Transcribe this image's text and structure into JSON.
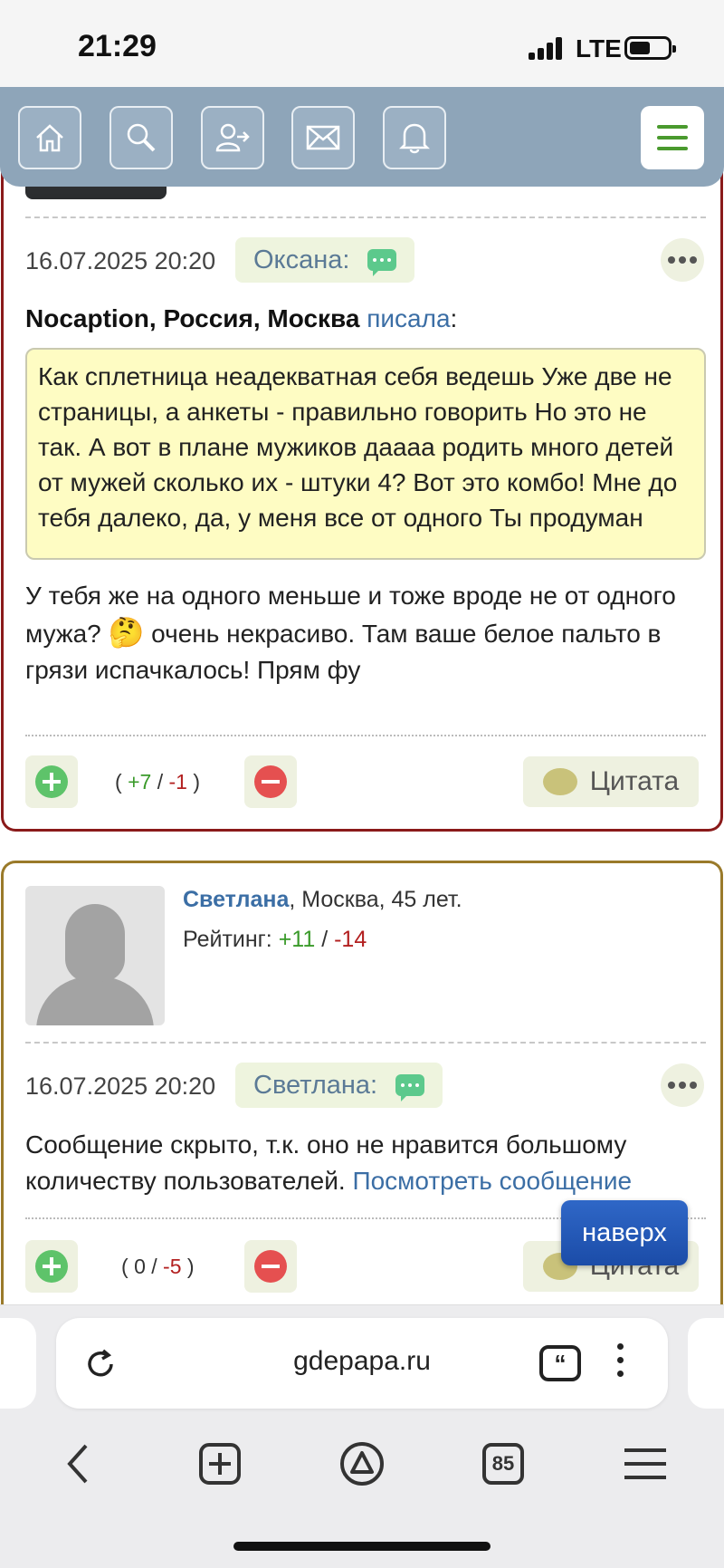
{
  "status": {
    "time": "21:29",
    "network": "LTE"
  },
  "nav": {
    "icons": [
      "home-icon",
      "search-icon",
      "login-icon",
      "mail-icon",
      "bell-icon",
      "menu-icon"
    ]
  },
  "post1": {
    "date": "16.07.2025 20:20",
    "author": "Оксана:",
    "quote_author": "Nocaption, Россия, Москва",
    "quote_verb": "писала",
    "quote_colon": ":",
    "quote_text": "Как сплетница неадекватная себя ведешь Уже две не страницы, а анкеты - правильно говорить Но это не так. А вот в плане мужиков даааа родить много детей от мужей сколько их - штуки 4? Вот это комбо! Мне до тебя далеко, да, у меня все от одного Ты продуман",
    "message_part1": "У тебя же на одного меньше и тоже вроде не от одного мужа?",
    "message_emoji": "🤔",
    "message_part2": "очень некрасиво. Там ваше белое пальто в грязи испачкалось! Прям фу",
    "votes": {
      "open": "(",
      "plus": "+7",
      "sep": "/",
      "minus": "-1",
      "close": ")"
    },
    "cite_label": "Цитата"
  },
  "post2": {
    "profile_name": "Светлана",
    "profile_info": ", Москва, 45 лет.",
    "rating_label": "Рейтинг:",
    "rating_plus": "+11",
    "rating_sep": "/",
    "rating_minus": "-14",
    "date": "16.07.2025 20:20",
    "author": "Светлана:",
    "hidden_text": "Сообщение скрыто, т.к. оно не нравится большому количеству пользователей.",
    "show_link": "Посмотреть сообщение",
    "votes": {
      "open": "(",
      "plus": "0",
      "sep": "/",
      "minus": "-5",
      "close": ")"
    },
    "cite_label": "Цитата"
  },
  "scroll_top_label": "наверх",
  "browser": {
    "url": "gdepapa.ru",
    "tabs_count": "85"
  },
  "colors": {
    "nav_bg": "#8ea5b9",
    "card1_border": "#8a1a1a",
    "card2_border": "#9a7a2a",
    "link": "#3b6ea5",
    "positive": "#3a9a2a",
    "negative": "#b32020",
    "quote_bg": "#fefcc3"
  }
}
